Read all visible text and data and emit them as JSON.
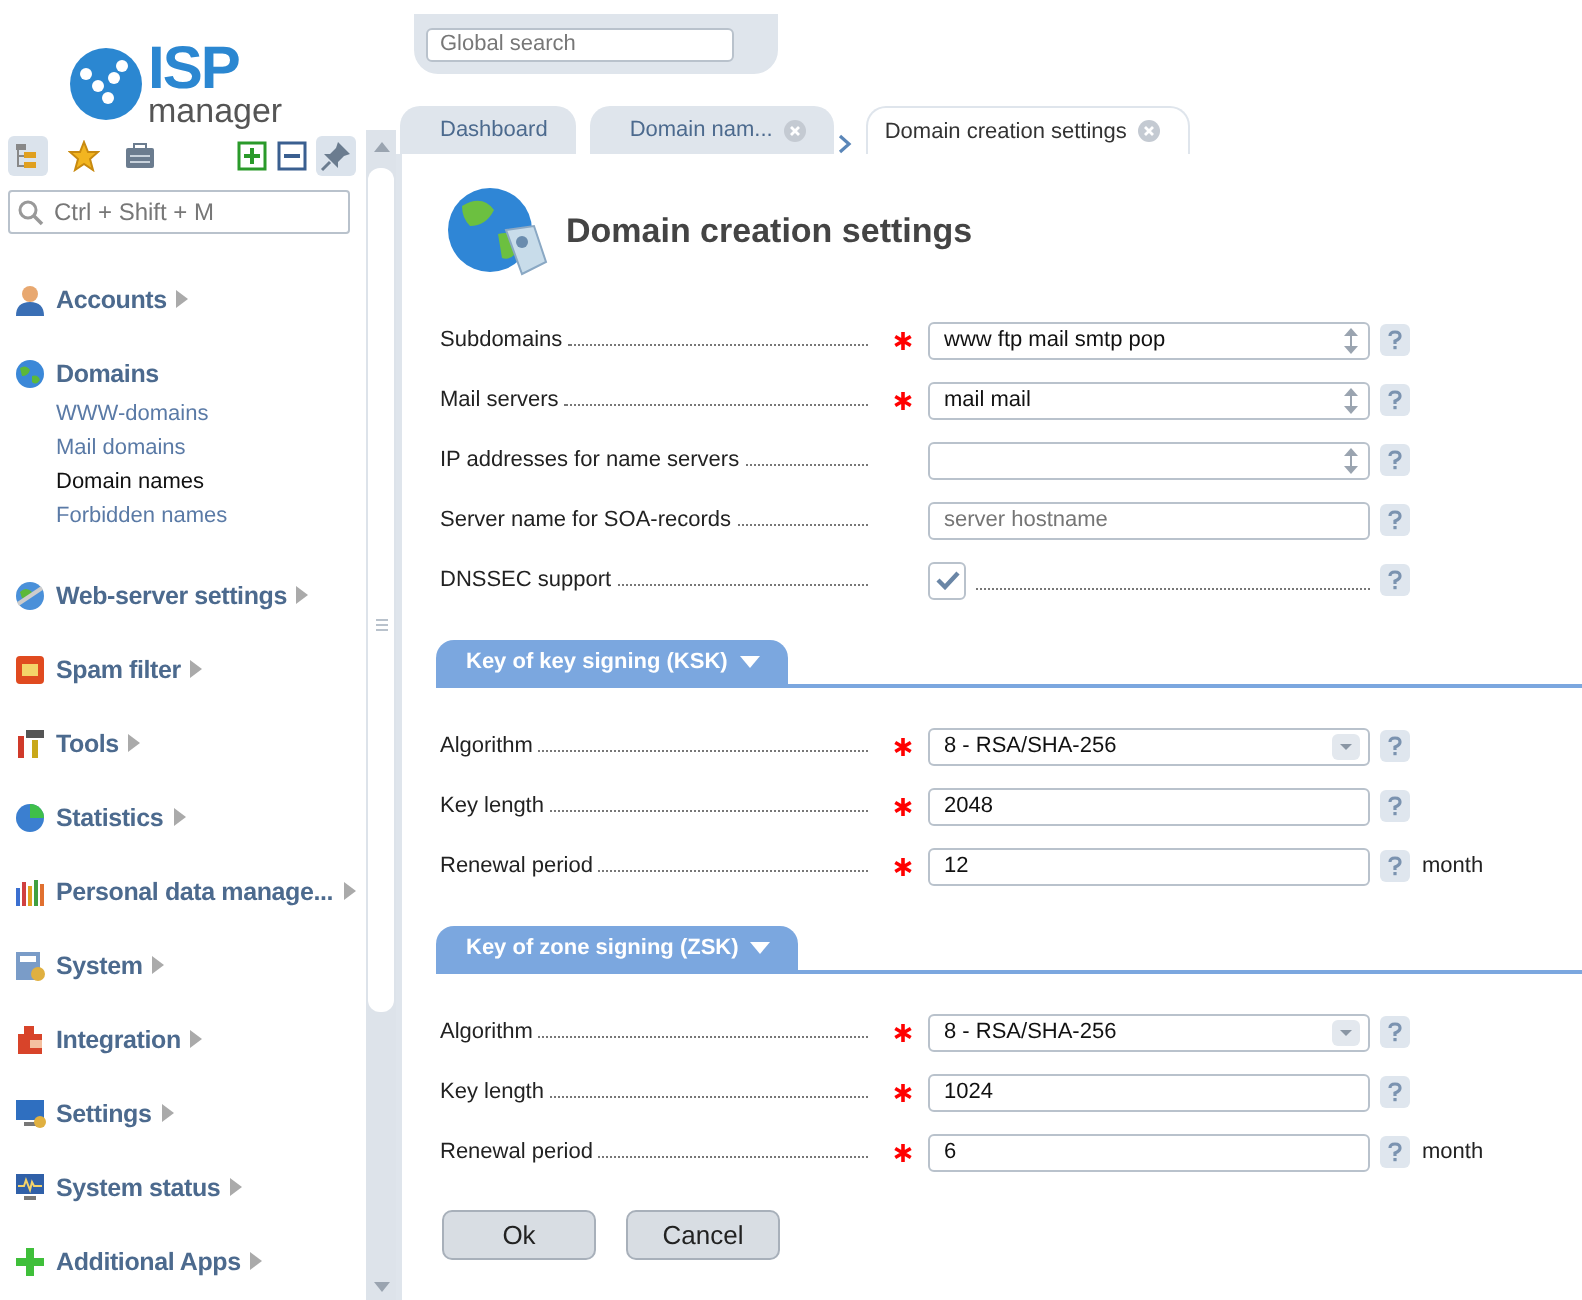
{
  "logo": {
    "brand": "ISP",
    "sub": "manager"
  },
  "toolbar": [
    {
      "kind": "tree",
      "pressed": true
    },
    {
      "kind": "star",
      "pressed": false
    },
    {
      "kind": "briefcase",
      "pressed": false
    },
    {
      "kind": "expand",
      "pressed": false
    },
    {
      "kind": "collapse",
      "pressed": false
    },
    {
      "kind": "pin",
      "pressed": true
    }
  ],
  "sidebar": {
    "search": {
      "placeholder": "Ctrl + Shift + M"
    },
    "items": [
      {
        "label": "Accounts",
        "expanded": false
      },
      {
        "label": "Domains",
        "expanded": true,
        "children": [
          {
            "label": "WWW-domains",
            "selected": false
          },
          {
            "label": "Mail domains",
            "selected": false
          },
          {
            "label": "Domain names",
            "selected": true
          },
          {
            "label": "Forbidden names",
            "selected": false
          }
        ]
      },
      {
        "label": "Web-server settings",
        "expanded": false
      },
      {
        "label": "Spam filter",
        "expanded": false
      },
      {
        "label": "Tools",
        "expanded": false
      },
      {
        "label": "Statistics",
        "expanded": false
      },
      {
        "label": "Personal data manage...",
        "expanded": false
      },
      {
        "label": "System",
        "expanded": false
      },
      {
        "label": "Integration",
        "expanded": false
      },
      {
        "label": "Settings",
        "expanded": false
      },
      {
        "label": "System status",
        "expanded": false
      },
      {
        "label": "Additional Apps",
        "expanded": false
      }
    ]
  },
  "global_search": {
    "placeholder": "Global search"
  },
  "tabs": [
    {
      "label": "Dashboard",
      "closable": false,
      "chained": false,
      "selected": false
    },
    {
      "label": "Domain nam...",
      "closable": true,
      "chained": false,
      "selected": false
    },
    {
      "label": "Domain creation settings",
      "closable": true,
      "chained": true,
      "selected": true
    }
  ],
  "form": {
    "title": "Domain creation settings",
    "fields": [
      {
        "kind": "multi",
        "label": "Subdomains",
        "required": true,
        "value": "www ftp mail smtp pop"
      },
      {
        "kind": "multi",
        "label": "Mail servers",
        "required": true,
        "value": "mail mail"
      },
      {
        "kind": "multi",
        "label": "IP addresses for name servers",
        "required": false
      },
      {
        "kind": "text",
        "label": "Server name for SOA-records",
        "required": false,
        "placeholder": "server hostname"
      },
      {
        "kind": "checkbox",
        "label": "DNSSEC support",
        "required": false,
        "checked": true
      }
    ],
    "sections": [
      {
        "title": "Key of key signing (KSK)",
        "expanded": true,
        "fields": [
          {
            "kind": "select",
            "label": "Algorithm",
            "required": true,
            "value": "8 - RSA/SHA-256"
          },
          {
            "kind": "text",
            "label": "Key length",
            "required": true,
            "value": "2048"
          },
          {
            "kind": "text",
            "label": "Renewal period",
            "required": true,
            "value": "12",
            "unit": "month"
          }
        ]
      },
      {
        "title": "Key of zone signing (ZSK)",
        "expanded": true,
        "fields": [
          {
            "kind": "select",
            "label": "Algorithm",
            "required": true,
            "value": "8 - RSA/SHA-256"
          },
          {
            "kind": "text",
            "label": "Key length",
            "required": true,
            "value": "1024"
          },
          {
            "kind": "text",
            "label": "Renewal period",
            "required": true,
            "value": "6",
            "unit": "month"
          }
        ]
      }
    ],
    "buttons": [
      "Ok",
      "Cancel"
    ]
  }
}
